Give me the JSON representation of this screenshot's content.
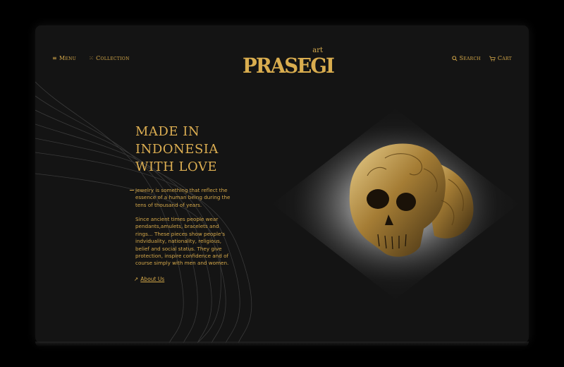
{
  "nav": {
    "menu_label": "Menu",
    "collection_label": "Collection",
    "search_label": "Search",
    "cart_label": "Cart",
    "menu_icon": "hamburger-icon",
    "collection_icon": "grid-icon",
    "search_icon": "search-icon",
    "cart_icon": "cart-icon"
  },
  "logo": {
    "main": "PRASEGI",
    "sup": "art"
  },
  "hero": {
    "headline_line1": "MADE IN",
    "headline_line2": "INDONESIA",
    "headline_line3": "WITH LOVE",
    "paragraph1": "Jewelry is something that reflect the essence of a human being during the tens of thousand of years.",
    "paragraph2": "Since ancient times people wear pendants,amulets, bracelets and rings... These pieces show people's indviduality, nationality, religious, belief and social status. They give protection, inspire confidence and of course simply with men and women.",
    "about_label": "About Us",
    "about_icon": "arrow-up-right-icon"
  },
  "colors": {
    "accent": "#d6a94a",
    "background": "#141414",
    "page": "#000000"
  }
}
